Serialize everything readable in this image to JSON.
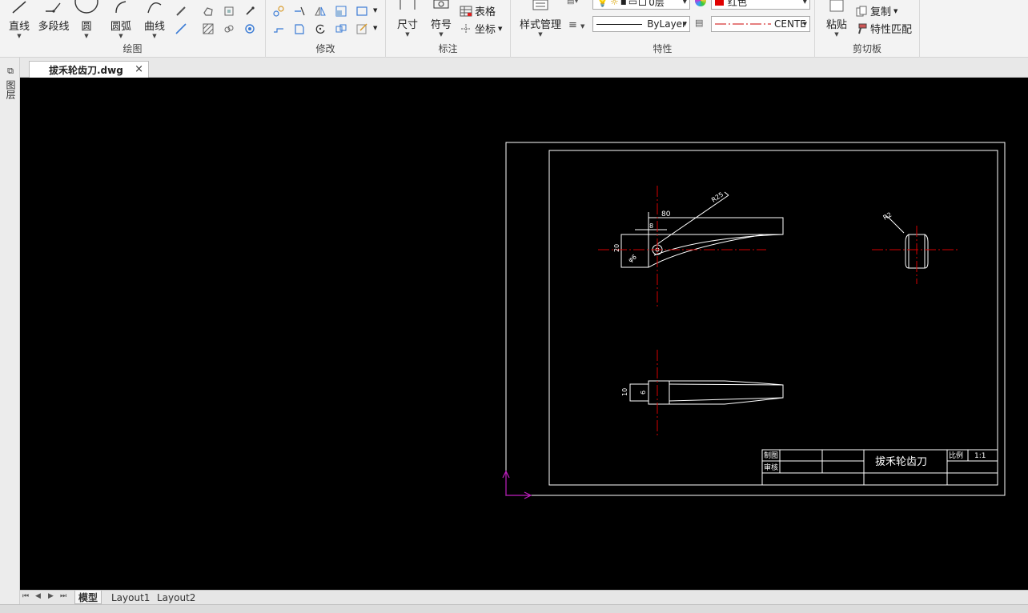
{
  "ribbon": {
    "draw": {
      "group_label": "绘图",
      "line": "直线",
      "polyline": "多段线",
      "circle": "圆",
      "arc": "圆弧",
      "curve": "曲线"
    },
    "modify": {
      "group_label": "修改"
    },
    "annotate": {
      "group_label": "标注",
      "dimension": "尺寸",
      "symbol": "符号",
      "table": "表格",
      "coordinate": "坐标"
    },
    "properties": {
      "group_label": "特性",
      "style_manager": "样式管理",
      "layer_value": "0层",
      "color_value": "红色",
      "linetype_value": "ByLayer",
      "lineweight_value": "CENTE"
    },
    "clipboard": {
      "group_label": "剪切板",
      "paste": "粘贴",
      "copy": "复制",
      "match_properties": "特性匹配"
    }
  },
  "tabs": {
    "document": "拔禾轮齿刀.dwg",
    "close": "×"
  },
  "leftbar": {
    "label": "图层"
  },
  "drawing": {
    "dim_top_80": "80",
    "dim_r25": "R25",
    "dim_8": "8",
    "dim_20": "20",
    "dim_phi6": "φ6",
    "dim_r2": "R2",
    "dim_10": "10",
    "dim_6": "6",
    "title_block": {
      "drawn_label": "制图",
      "checked_label": "审核",
      "part_name": "拔禾轮齿刀",
      "scale_label": "比例",
      "scale_value": "1:1"
    }
  },
  "layouts": {
    "model": "模型",
    "layout1": "Layout1",
    "layout2": "Layout2"
  },
  "colors": {
    "canvas": "#000000",
    "center_line": "#d40000",
    "ucs": "#c020c0",
    "layer_red": "#e00000"
  }
}
